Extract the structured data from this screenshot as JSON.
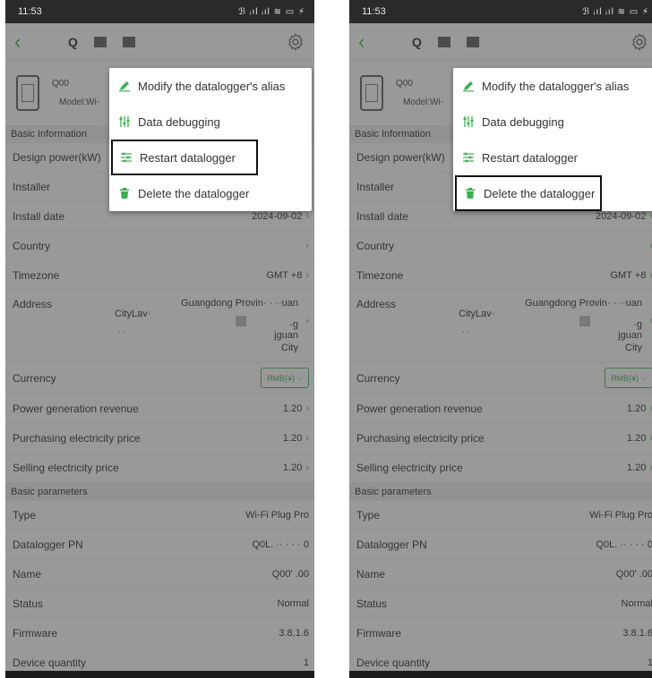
{
  "status_bar": {
    "time": "11:53",
    "icons": "ℬ ᵢıl ᵢıl ≋ ▭ ⚡"
  },
  "toolbar": {
    "back": "‹",
    "search_glyph": "Q",
    "settings_icon": "gear-icon"
  },
  "device": {
    "name": "Q00",
    "model": "Model:Wi-"
  },
  "sections": {
    "basic_information": "Basic Information",
    "basic_parameters": "Basic parameters"
  },
  "rows": {
    "design_power": {
      "label": "Design power(kW)"
    },
    "installer": {
      "label": "Installer"
    },
    "install_date": {
      "label": "Install date",
      "value": "2024-09-02"
    },
    "country": {
      "label": "Country",
      "value": ""
    },
    "timezone": {
      "label": "Timezone",
      "value": "GMT +8"
    },
    "address": {
      "label": "Address",
      "line1": "Guangdong Provin· · ··uan",
      "line2": "CityLav·",
      "line3": "·g",
      "line3b": "jguan",
      "line4": "City",
      "dots": "· ·"
    },
    "currency": {
      "label": "Currency",
      "value": "RMB(¥)"
    },
    "power_generation_revenue": {
      "label": "Power generation revenue",
      "value": "1.20"
    },
    "purchasing_price": {
      "label": "Purchasing electricity price",
      "value": "1.20"
    },
    "selling_price": {
      "label": "Selling electricity price",
      "value": "1.20"
    },
    "type": {
      "label": "Type",
      "value": "Wi-Fi Plug Pro"
    },
    "datalogger_pn": {
      "label": "Datalogger PN",
      "value": "Q0L.      ·· · · · 0"
    },
    "name": {
      "label": "Name",
      "value": "Q00'        .00"
    },
    "status": {
      "label": "Status",
      "value": "Normal"
    },
    "firmware": {
      "label": "Firmware",
      "value": "3.8.1.6"
    },
    "device_quantity": {
      "label": "Device quantity",
      "value": "1"
    }
  },
  "menu": {
    "modify_alias": "Modify the datalogger's alias",
    "data_debugging": "Data debugging",
    "restart": "Restart datalogger",
    "delete": "Delete the datalogger"
  },
  "colors": {
    "accent": "#3bb04c",
    "delete_icon": "#3bb04c"
  },
  "chevron": "›",
  "left_highlight": "restart",
  "right_highlight": "delete"
}
